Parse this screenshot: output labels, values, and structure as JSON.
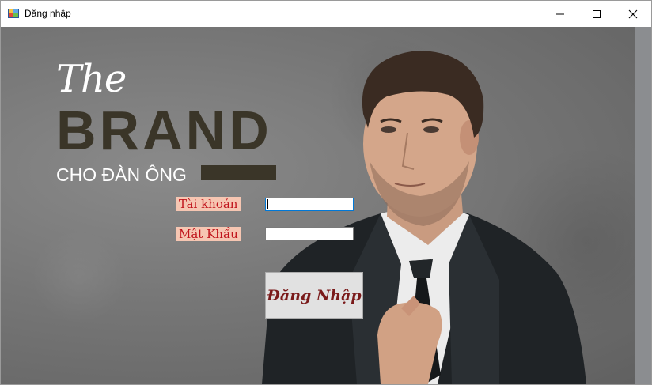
{
  "window": {
    "title": "Đăng nhập",
    "controls": {
      "minimize": "minimize-icon",
      "maximize": "maximize-icon",
      "close": "close-icon"
    }
  },
  "brand": {
    "the": "The",
    "main": "BRAND",
    "sub": "CHO ĐÀN ÔNG"
  },
  "form": {
    "username_label": "Tài khoản",
    "username_value": "",
    "password_label": "Mật Khẩu",
    "password_value": "",
    "login_button": "Đăng Nhập"
  },
  "colors": {
    "label_bg": "#f6c6b2",
    "label_text": "#c0141c",
    "brand_dark": "#3a3528",
    "button_text": "#7a1a1a"
  }
}
